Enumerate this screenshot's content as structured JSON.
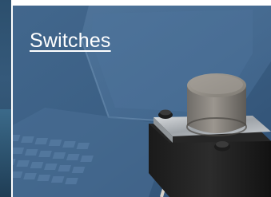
{
  "card": {
    "title": "Switches"
  },
  "icons": {
    "product": "tactile-switch-image",
    "background": "laptop-keyboard-image"
  },
  "colors": {
    "overlay": "#3d6186",
    "title": "#ffffff"
  }
}
